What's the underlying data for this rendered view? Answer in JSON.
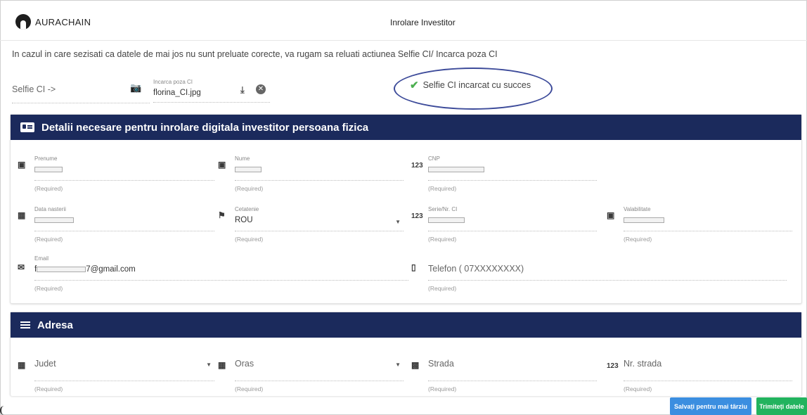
{
  "app": {
    "logo_text": "AURACHAIN",
    "page_title": "Inrolare Investitor"
  },
  "notice": "In cazul in care sezisati ca datele de mai jos nu sunt preluate corecte, va rugam sa reluati actiunea Selfie CI/ Incarca poza CI",
  "upload": {
    "selfie_label": "Selfie CI ->",
    "upload_label": "Incarca poza CI",
    "file_name": "florina_CI.jpg",
    "success_message": "Selfie CI incarcat cu succes"
  },
  "details_panel": {
    "title": "Detalii necesare pentru inrolare digitala investitor persoana fizica",
    "fields": {
      "prenume": {
        "label": "Prenume",
        "required": "(Required)",
        "icon": "badge-icon"
      },
      "nume": {
        "label": "Nume",
        "required": "(Required)",
        "icon": "badge-icon"
      },
      "cnp": {
        "label": "CNP",
        "required": "(Required)",
        "icon": "numeric-icon"
      },
      "data_nasterii": {
        "label": "Data nasterii",
        "required": "(Required)",
        "icon": "calendar-icon"
      },
      "cetatenie": {
        "label": "Cetatenie",
        "value": "ROU",
        "required": "(Required)",
        "icon": "flag-icon"
      },
      "serie_ci": {
        "label": "Serie/Nr. CI",
        "required": "(Required)",
        "icon": "numeric-icon"
      },
      "valabilitate": {
        "label": "Valabilitate",
        "required": "(Required)",
        "icon": "calendar-star-icon"
      },
      "email": {
        "label": "Email",
        "value_prefix": "f",
        "value_suffix": "7@gmail.com",
        "required": "(Required)",
        "icon": "mail-icon"
      },
      "telefon": {
        "placeholder": "Telefon ( 07XXXXXXXX)",
        "required": "(Required)",
        "icon": "phone-icon"
      }
    }
  },
  "address_panel": {
    "title": "Adresa",
    "fields": {
      "judet": {
        "placeholder": "Judet",
        "required": "(Required)"
      },
      "oras": {
        "placeholder": "Oras",
        "required": "(Required)"
      },
      "strada": {
        "placeholder": "Strada",
        "required": "(Required)"
      },
      "nr_strada": {
        "placeholder": "Nr. strada",
        "required": "(Required)"
      }
    }
  },
  "buttons": {
    "save": "Salvați pentru mai târziu",
    "send": "Trimiteți datele"
  },
  "colors": {
    "panel_header": "#1b2a5c",
    "save_button": "#3b8ee0",
    "send_button": "#22b35e",
    "success_check": "#4caf50",
    "highlight_ellipse": "#3d4b9a"
  }
}
